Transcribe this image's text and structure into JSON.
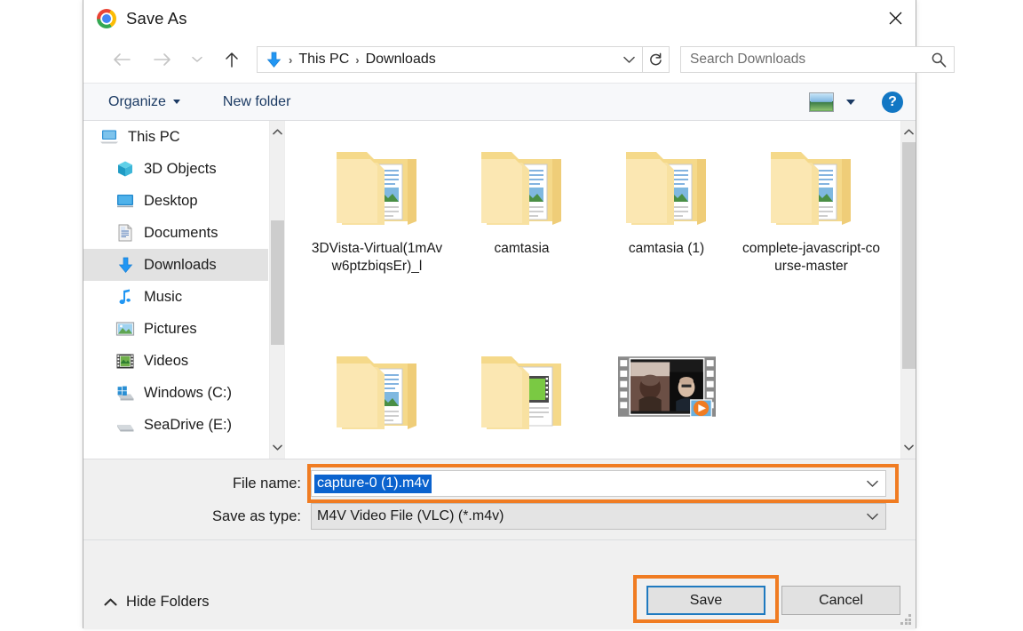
{
  "window": {
    "title": "Save As",
    "app_icon": "chrome-logo",
    "close_label": "×"
  },
  "nav": {
    "back_icon": "arrow-left-icon",
    "forward_icon": "arrow-right-icon",
    "recent_icon": "chevron-down-icon",
    "up_icon": "arrow-up-icon",
    "refresh_icon": "refresh-icon",
    "breadcrumb": {
      "location_icon": "downloads-arrow-icon",
      "separator": "›",
      "items": [
        "This PC",
        "Downloads"
      ],
      "dropdown_icon": "chevron-down-icon"
    },
    "search": {
      "placeholder": "Search Downloads",
      "value": "",
      "icon": "search-icon"
    }
  },
  "toolbar": {
    "organize_label": "Organize",
    "new_folder_label": "New folder",
    "view_icon": "picture-view-icon",
    "view_dropdown_icon": "chevron-down-icon",
    "help_label": "?"
  },
  "sidebar": {
    "items": [
      {
        "label": "This PC",
        "icon": "computer-icon",
        "indent": false,
        "selected": false
      },
      {
        "label": "3D Objects",
        "icon": "cube-icon",
        "indent": true,
        "selected": false
      },
      {
        "label": "Desktop",
        "icon": "desktop-icon",
        "indent": true,
        "selected": false
      },
      {
        "label": "Documents",
        "icon": "documents-icon",
        "indent": true,
        "selected": false
      },
      {
        "label": "Downloads",
        "icon": "downloads-icon",
        "indent": true,
        "selected": true
      },
      {
        "label": "Music",
        "icon": "music-icon",
        "indent": true,
        "selected": false
      },
      {
        "label": "Pictures",
        "icon": "pictures-icon",
        "indent": true,
        "selected": false
      },
      {
        "label": "Videos",
        "icon": "videos-icon",
        "indent": true,
        "selected": false
      },
      {
        "label": "Windows (C:)",
        "icon": "windows-drive-icon",
        "indent": true,
        "selected": false
      },
      {
        "label": "SeaDrive (E:)",
        "icon": "drive-icon",
        "indent": true,
        "selected": false
      }
    ],
    "scroll_up_icon": "chevron-up-icon",
    "scroll_down_icon": "chevron-down-icon"
  },
  "files": {
    "items": [
      {
        "name": "3DVista-Virtual(1mAvw6ptzbiqsEr)_l",
        "type": "folder"
      },
      {
        "name": "camtasia",
        "type": "folder"
      },
      {
        "name": "camtasia (1)",
        "type": "folder"
      },
      {
        "name": "complete-javascript-course-master",
        "type": "folder"
      },
      {
        "name": "",
        "type": "folder"
      },
      {
        "name": "",
        "type": "folder-media"
      },
      {
        "name": "",
        "type": "video"
      },
      {
        "name": "",
        "type": "empty"
      }
    ],
    "scroll_up_icon": "chevron-up-icon",
    "scroll_down_icon": "chevron-down-icon"
  },
  "form": {
    "file_name_label": "File name:",
    "file_name_value": "capture-0 (1).m4v",
    "file_name_dropdown_icon": "chevron-down-icon",
    "save_as_type_label": "Save as type:",
    "save_as_type_value": "M4V Video File (VLC) (*.m4v)",
    "save_as_type_dropdown_icon": "chevron-down-icon"
  },
  "footer": {
    "hide_folders_label": "Hide Folders",
    "hide_folders_icon": "chevron-up-icon",
    "save_label": "Save",
    "cancel_label": "Cancel",
    "resize_grip_icon": "resize-grip-icon"
  },
  "colors": {
    "highlight_orange": "#f07c22",
    "selection_blue": "#0b63ce",
    "default_button_border": "#1f7ac0",
    "accent_blue": "#1277c4"
  }
}
